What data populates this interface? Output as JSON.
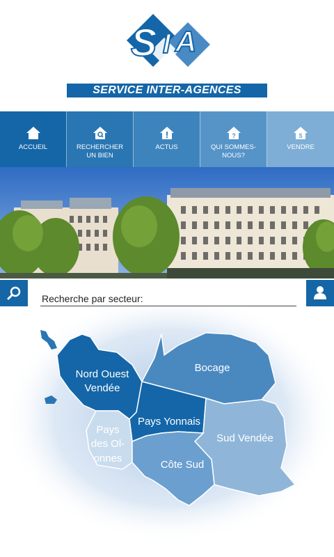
{
  "header": {
    "logo_text": "SIA",
    "tagline": "SERVICE INTER-AGENCES"
  },
  "nav": {
    "items": [
      {
        "label": "ACCUEIL",
        "icon": "home-icon"
      },
      {
        "label": "RECHERCHER UN BIEN",
        "icon": "search-house-icon"
      },
      {
        "label": "ACTUS",
        "icon": "alert-house-icon"
      },
      {
        "label": "QUI SOMMES-NOUS?",
        "icon": "question-house-icon"
      },
      {
        "label": "VENDRE",
        "icon": "dollar-house-icon"
      }
    ]
  },
  "search": {
    "value": "Recherche par secteur:"
  },
  "map": {
    "regions": [
      {
        "name": "Nord Ouest Vendée",
        "line1": "Nord Ouest",
        "line2": "Vendée"
      },
      {
        "name": "Bocage"
      },
      {
        "name": "Pays Yonnais"
      },
      {
        "name": "Pays des Olonnes",
        "line1": "Pays",
        "line2": "des Ol-",
        "line3": "onnes"
      },
      {
        "name": "Sud Vendée"
      },
      {
        "name": "Côte Sud"
      }
    ]
  },
  "colors": {
    "primary": "#1566a6",
    "region_dark": "#1466a8",
    "region_mid": "#4a89c0",
    "region_light": "#8fb6d9",
    "region_pale": "#c9dcee"
  }
}
